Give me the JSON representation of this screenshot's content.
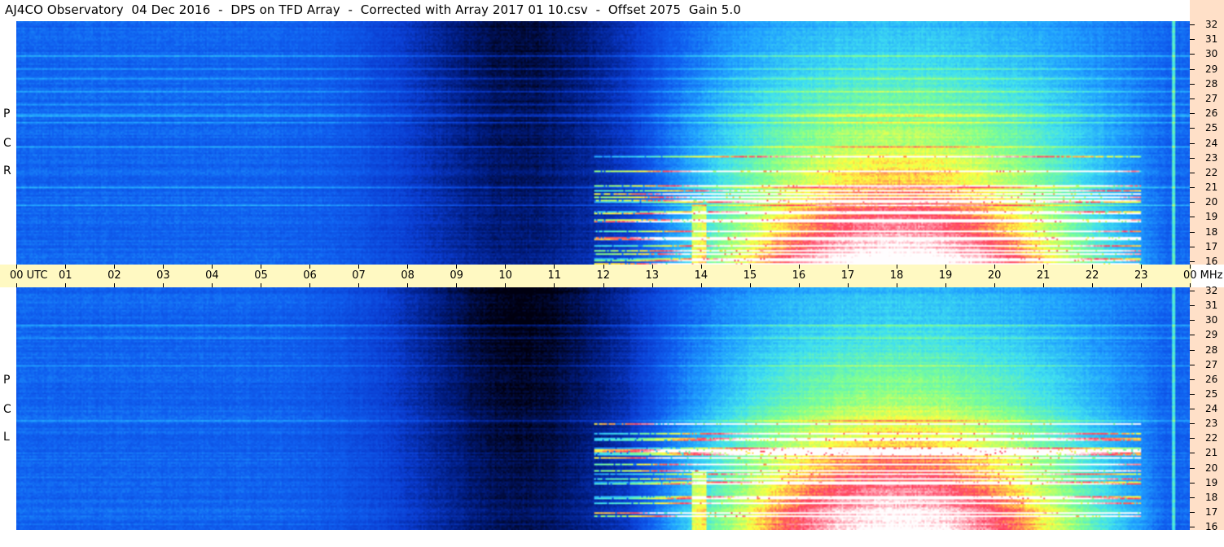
{
  "title": "AJ4CO Observatory  04 Dec 2016  -  DPS on TFD Array  -  Corrected with Array 2017 01 10.csv  -  Offset 2075  Gain 5.0",
  "panels": [
    {
      "id": "rcp",
      "label": [
        "R",
        "C",
        "P"
      ]
    },
    {
      "id": "lcp",
      "label": [
        "L",
        "C",
        "P"
      ]
    }
  ],
  "time_axis": {
    "labels": [
      "00 UTC",
      "01",
      "02",
      "03",
      "04",
      "05",
      "06",
      "07",
      "08",
      "09",
      "10",
      "11",
      "12",
      "13",
      "14",
      "15",
      "16",
      "17",
      "18",
      "19",
      "20",
      "21",
      "22",
      "23",
      "00 MHz"
    ]
  },
  "freq_axis": {
    "labels": [
      "32",
      "31",
      "30",
      "29",
      "28",
      "27",
      "26",
      "25",
      "24",
      "23",
      "22",
      "21",
      "20",
      "19",
      "18",
      "17",
      "16"
    ]
  },
  "colors": {
    "axis_bg_time": "#fff9c2",
    "axis_bg_freq": "#ffe0c8",
    "colormap": [
      "#000010",
      "#001a7a",
      "#0a3cd0",
      "#1060f0",
      "#20a0ff",
      "#40e0f0",
      "#80ff90",
      "#ffff40",
      "#ff4060",
      "#ffffff"
    ]
  },
  "chart_data": {
    "type": "heatmap",
    "title": "AJ4CO Observatory  04 Dec 2016  -  DPS on TFD Array  -  Corrected with Array 2017 01 10.csv  -  Offset 2075  Gain 5.0",
    "x_range": [
      0,
      24
    ],
    "y_range": [
      16,
      32
    ],
    "series": [
      {
        "name": "RCP",
        "description": "dynamic spectrum, right circular polarization"
      },
      {
        "name": "LCP",
        "description": "dynamic spectrum, left circular polarization"
      }
    ]
  }
}
